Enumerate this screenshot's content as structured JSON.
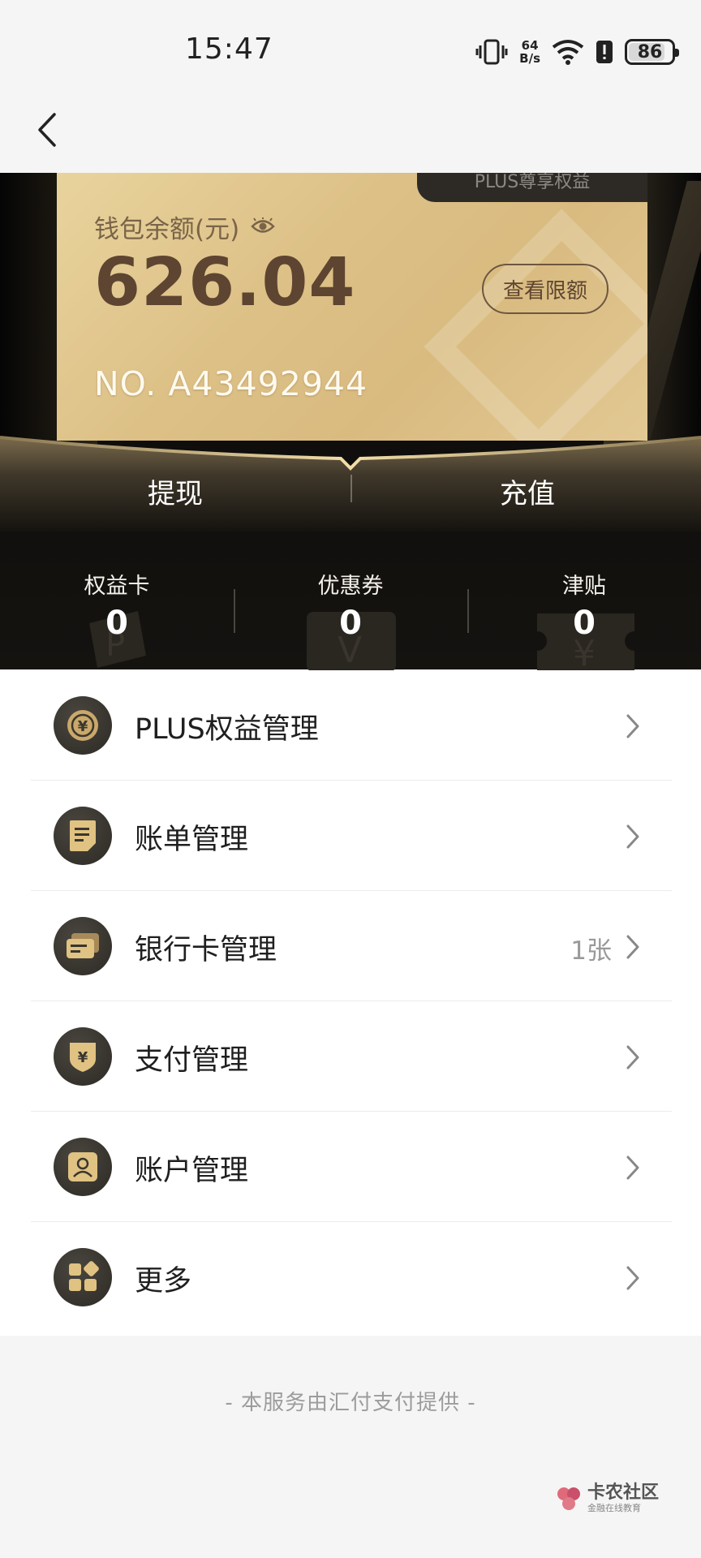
{
  "status_bar": {
    "time": "15:47",
    "net_speed_value": "64",
    "net_speed_unit": "B/s",
    "battery": "86"
  },
  "card": {
    "badge": "PLUS尊享权益",
    "balance_label": "钱包余额(元)",
    "balance": "626.04",
    "limit_button": "查看限额",
    "number": "NO. A43492944"
  },
  "actions": {
    "withdraw": "提现",
    "recharge": "充值"
  },
  "stats": [
    {
      "label": "权益卡",
      "value": "0",
      "icon": "card-icon"
    },
    {
      "label": "优惠券",
      "value": "0",
      "icon": "coupon-icon"
    },
    {
      "label": "津贴",
      "value": "0",
      "icon": "yuan-ticket-icon"
    }
  ],
  "menu": [
    {
      "label": "PLUS权益管理",
      "extra": "",
      "icon": "coin-icon"
    },
    {
      "label": "账单管理",
      "extra": "",
      "icon": "bill-icon"
    },
    {
      "label": "银行卡管理",
      "extra": "1张",
      "icon": "bank-card-icon"
    },
    {
      "label": "支付管理",
      "extra": "",
      "icon": "payment-shield-icon"
    },
    {
      "label": "账户管理",
      "extra": "",
      "icon": "account-icon"
    },
    {
      "label": "更多",
      "extra": "",
      "icon": "more-apps-icon"
    }
  ],
  "footer": "- 本服务由汇付支付提供 -",
  "watermark": {
    "title": "卡农社区",
    "subtitle": "金融在线教育"
  },
  "colors": {
    "gold_light": "#e9d39d",
    "gold_dark": "#5e4531",
    "icon_bg": "#3a362f",
    "icon_gold": "#e0c282"
  }
}
